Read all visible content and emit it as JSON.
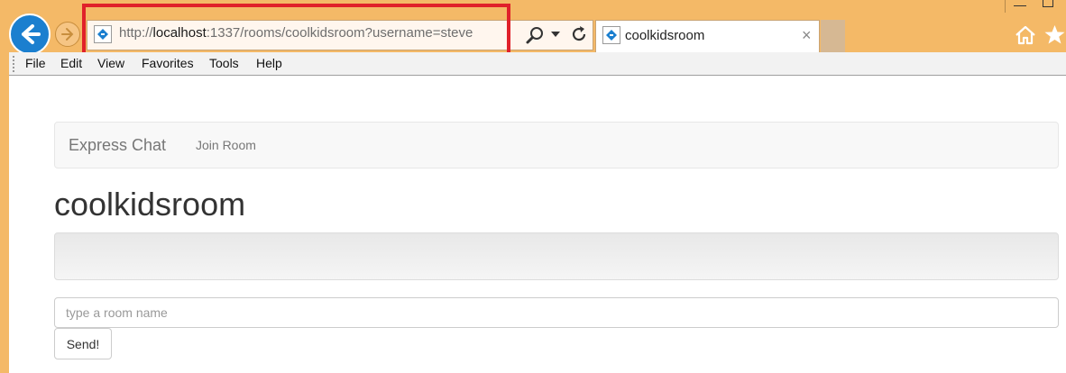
{
  "browser": {
    "url_prefix": "http://",
    "url_host": "localhost",
    "url_rest": ":1337/rooms/coolkidsroom?username=steve",
    "tab_title": "coolkidsroom",
    "tab_close": "×",
    "highlight_color": "#e0212a",
    "accent_color": "#1b7fcf"
  },
  "menu": [
    "File",
    "Edit",
    "View",
    "Favorites",
    "Tools",
    "Help"
  ],
  "nav": {
    "brand": "Express Chat",
    "join_room": "Join Room"
  },
  "page": {
    "title": "coolkidsroom",
    "input_placeholder": "type a room name",
    "send_label": "Send!"
  },
  "icons": [
    "back-arrow-icon",
    "forward-arrow-icon",
    "site-icon",
    "search-icon",
    "dropdown-icon",
    "refresh-icon",
    "home-icon",
    "favorites-star-icon"
  ]
}
